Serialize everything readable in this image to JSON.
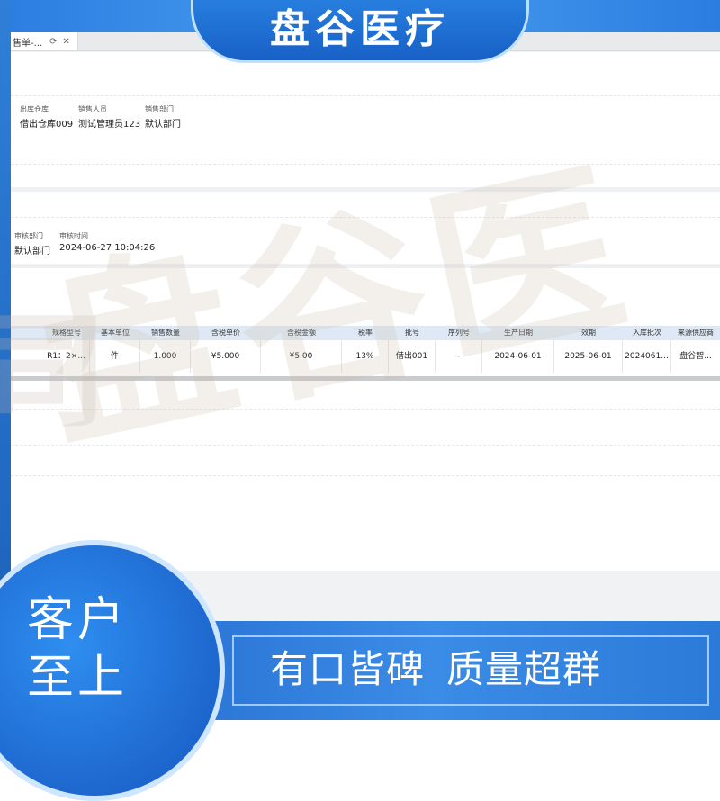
{
  "brand": {
    "title": "盘谷医疗",
    "watermark": "盘谷医",
    "watermark_side": "司"
  },
  "tab": {
    "label": "售单-...",
    "refresh_icon": "refresh-icon",
    "close_icon": "close-icon"
  },
  "header_fields": [
    {
      "label": "出库仓库",
      "value": "借出仓库009"
    },
    {
      "label": "销售人员",
      "value": "测试管理员123"
    },
    {
      "label": "销售部门",
      "value": "默认部门"
    }
  ],
  "audit_fields": [
    {
      "label": "审核部门",
      "value": "默认部门"
    },
    {
      "label": "审核时间",
      "value": "2024-06-27 10:04:26"
    }
  ],
  "table": {
    "columns": [
      "规格型号",
      "基本单位",
      "销售数量",
      "含税单价",
      "含税金额",
      "税率",
      "批号",
      "序列号",
      "生产日期",
      "效期",
      "入库批次",
      "来源供应商"
    ],
    "rows": [
      [
        "R1：2×...",
        "件",
        "1.000",
        "¥5.000",
        "¥5.00",
        "13%",
        "借出001",
        "-",
        "2024-06-01",
        "2025-06-01",
        "2024061...",
        "盘谷智..."
      ]
    ]
  },
  "bottom": {
    "circle_line1": "客户",
    "circle_line2": "至上",
    "slogan1": "有口皆碑",
    "slogan2": "质量超群"
  },
  "colors": {
    "brand_blue": "#1f6fd6",
    "table_header": "#dfe9f5"
  }
}
